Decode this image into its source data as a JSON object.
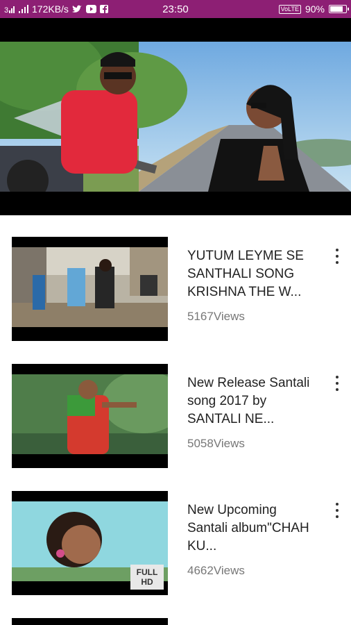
{
  "status_bar": {
    "net_speed": "172KB/s",
    "time": "23:50",
    "volte": "VoLTE",
    "battery_text": "90%",
    "battery_level": 0.9,
    "icons": [
      "sim-signal-icon",
      "signal-bars-icon",
      "twitter-icon",
      "youtube-icon",
      "facebook-icon"
    ]
  },
  "player": {
    "name": "video-player"
  },
  "videos": [
    {
      "title": "YUTUM LEYME SE SANTHALI SONG KRISHNA THE W...",
      "views": "5167Views"
    },
    {
      "title": "New Release Santali song 2017 by SANTALI NE...",
      "views": "5058Views"
    },
    {
      "title": "New Upcoming Santali album\"CHAH KU...",
      "views": "4662Views",
      "badge": "FULL HD"
    }
  ],
  "colors": {
    "status_bar": "#8d1f74",
    "title_text": "#222222",
    "views_text": "#777777"
  }
}
